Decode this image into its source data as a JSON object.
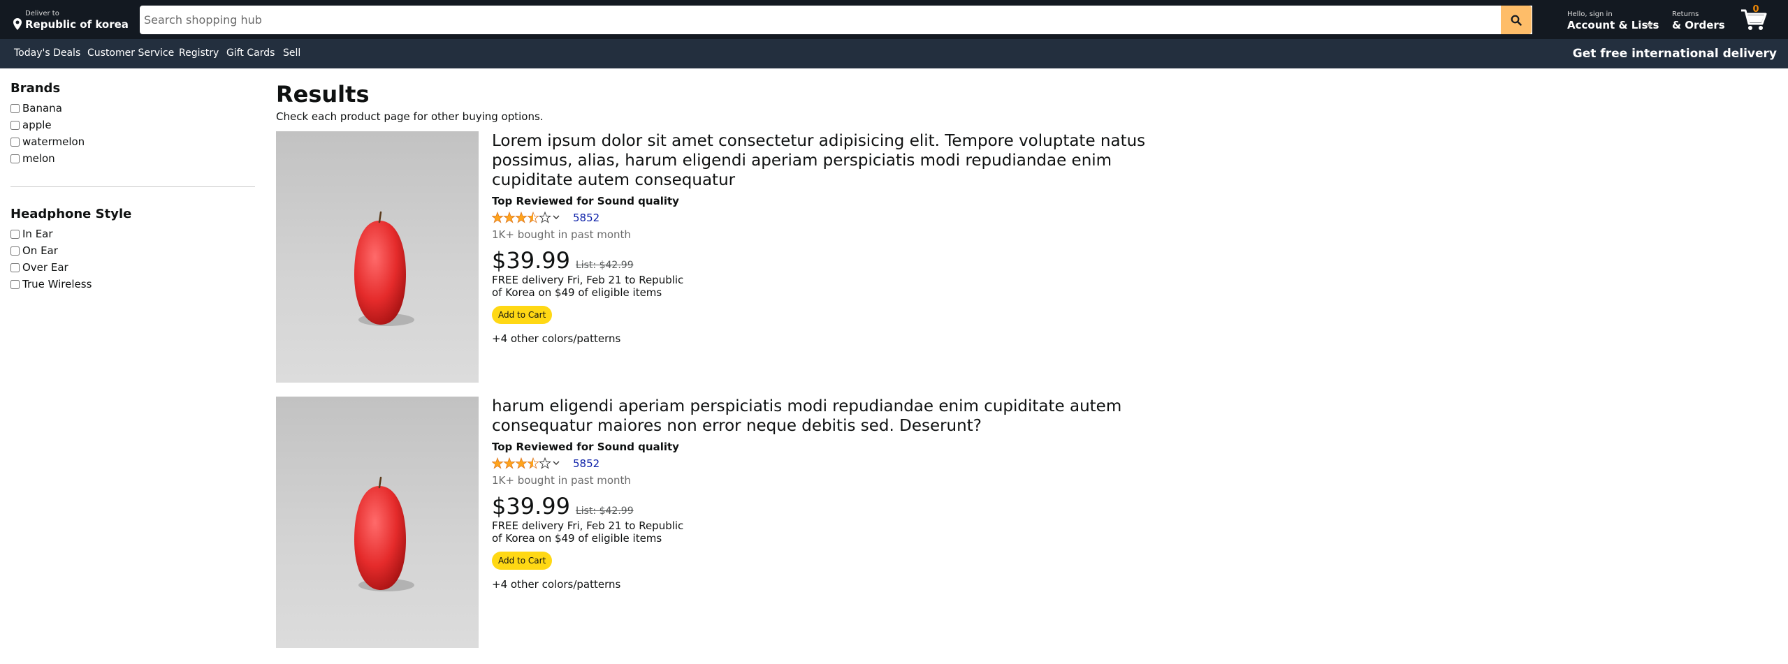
{
  "header": {
    "deliver_small": "Deliver to",
    "deliver_location": "Republic of korea",
    "search_placeholder": "Search shopping hub",
    "account_small": "Hello, sign in",
    "account_big": "Account & Lists",
    "returns_small": "Returns",
    "returns_big": "& Orders",
    "cart_count": "0"
  },
  "subnav": {
    "items": [
      "Today's Deals",
      "Customer Service",
      "Registry",
      "Gift Cards",
      "Sell"
    ],
    "right_text": "Get free international delivery"
  },
  "sidebar": {
    "brands_title": "Brands",
    "brands": [
      "Banana",
      "apple",
      "watermelon",
      "melon"
    ],
    "style_title": "Headphone Style",
    "styles": [
      "In Ear",
      "On Ear",
      "Over Ear",
      "True Wireless"
    ]
  },
  "results": {
    "title": "Results",
    "subtitle": "Check each product page for other buying options.",
    "products": [
      {
        "title": "Lorem ipsum dolor sit amet consectetur adipisicing elit. Tempore voluptate natus possimus, alias, harum eligendi aperiam perspiciatis modi repudiandae enim cupiditate autem consequatur",
        "badge": "Top Reviewed for Sound quality",
        "rating": 3.5,
        "rating_count": "5852",
        "bought": "1K+ bought in past month",
        "price": "$39.99",
        "list_price": "List: $42.99",
        "delivery": "FREE delivery Fri, Feb 21 to Republic of Korea on $49 of eligible items",
        "add_to_cart": "Add to Cart",
        "colors": "+4 other colors/patterns"
      },
      {
        "title": "harum eligendi aperiam perspiciatis modi repudiandae enim cupiditate autem consequatur maiores non error neque debitis sed. Deserunt?",
        "badge": "Top Reviewed for Sound quality",
        "rating": 3.5,
        "rating_count": "5852",
        "bought": "1K+ bought in past month",
        "price": "$39.99",
        "list_price": "List: $42.99",
        "delivery": "FREE delivery Fri, Feb 21 to Republic of Korea on $49 of eligible items",
        "add_to_cart": "Add to Cart",
        "colors": "+4 other colors/patterns"
      }
    ]
  },
  "colors": {
    "header_bg": "#131921",
    "subnav_bg": "#232f3e",
    "search_button": "#febd69",
    "add_to_cart": "#ffd814",
    "star": "#ffa41c",
    "rating_link": "#0b1fa8"
  }
}
